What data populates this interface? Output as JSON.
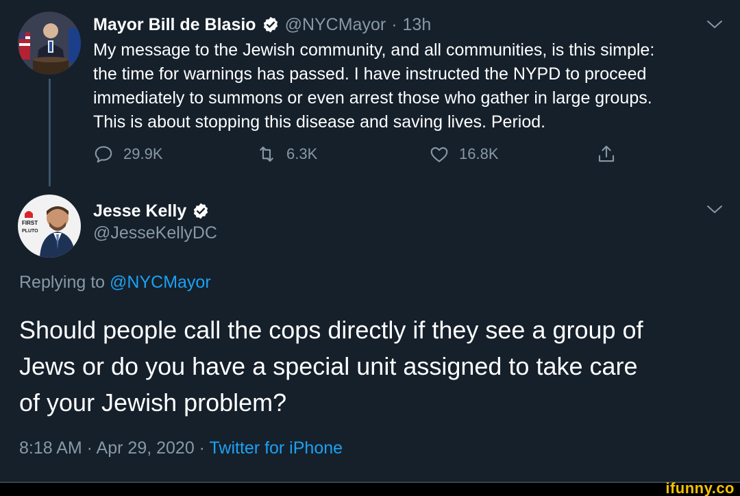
{
  "original_tweet": {
    "name": "Mayor Bill de Blasio",
    "handle": "@NYCMayor",
    "separator": "·",
    "time_ago": "13h",
    "text_lines": [
      "My message to the Jewish community, and all communities, is this simple:",
      "the time for warnings has passed. I have instructed the NYPD to proceed",
      "immediately to summons or even arrest those who gather in large groups.",
      "This is about stopping this disease and saving lives. Period."
    ],
    "replies": "29.9K",
    "retweets": "6.3K",
    "likes": "16.8K"
  },
  "reply_tweet": {
    "name": "Jesse Kelly",
    "handle": "@JesseKellyDC",
    "replying_prefix": "Replying to",
    "replying_to": "@NYCMayor",
    "text_lines": [
      "Should people call the cops directly if they see a group of",
      "Jews or do you have a special unit assigned to take care",
      "of your Jewish problem?"
    ],
    "timestamp": "8:18 AM · Apr 29, 2020",
    "dot": " · ",
    "client": "Twitter for iPhone"
  },
  "avatar_text": {
    "brand_line1": "FIRST",
    "brand_line2": "PLUTO"
  },
  "watermark": "ifunny.co",
  "colors": {
    "background": "#15202b",
    "text": "#ffffff",
    "muted": "#8899a6",
    "link": "#1da1f2",
    "verified": "#ffffff"
  },
  "icons": [
    "verified-badge-icon",
    "chevron-down-icon",
    "reply-icon",
    "retweet-icon",
    "like-icon",
    "share-icon"
  ]
}
